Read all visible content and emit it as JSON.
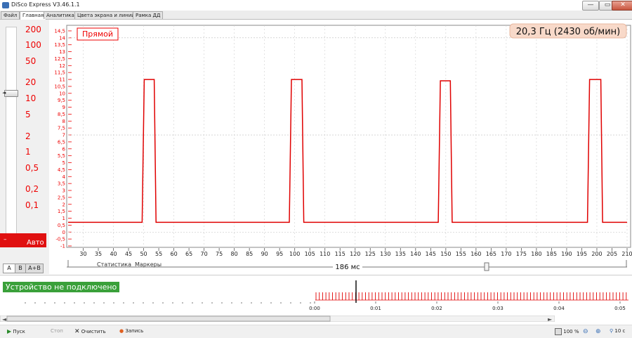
{
  "window": {
    "title": "DiSco Express V3.46.1.1",
    "minimize": "—",
    "maximize": "▭",
    "close": "✕"
  },
  "menu_tabs": [
    "Файл",
    "Главная",
    "Аналитика",
    "Цвета экрана и линий",
    "Рамка ДД"
  ],
  "left_panel": {
    "scale_labels": [
      "200",
      "100",
      "50",
      "20",
      "10",
      "5",
      "2",
      "1",
      "0,5",
      "0,2",
      "0,1"
    ],
    "slider_tick": "◄",
    "auto_dash": "–",
    "auto_label": "Авто",
    "channel_tabs": [
      "A",
      "B",
      "A+B"
    ],
    "selected_scale": "20"
  },
  "chart": {
    "mode_label": "Прямой",
    "frequency_readout": "20,3 Гц (2430 об/мин)",
    "statistics_label": "Статистика",
    "markers_label": "Маркеры",
    "span_label": "186 мс",
    "accent": "#e00000"
  },
  "chart_data": {
    "type": "line",
    "xlabel": "",
    "ylabel": "",
    "xlim": [
      25,
      210
    ],
    "ylim": [
      -1,
      14.7
    ],
    "x_ticks": [
      30,
      35,
      40,
      45,
      50,
      55,
      60,
      65,
      70,
      75,
      80,
      85,
      90,
      95,
      100,
      105,
      110,
      115,
      120,
      125,
      130,
      135,
      140,
      145,
      150,
      155,
      160,
      165,
      170,
      175,
      180,
      185,
      190,
      195,
      200,
      205,
      210
    ],
    "y_ticks": [
      "-1",
      "-0,5",
      "0",
      "0,5",
      "1",
      "1,5",
      "2",
      "2,5",
      "3",
      "3,5",
      "4",
      "4,5",
      "5",
      "5,5",
      "6",
      "6,5",
      "7",
      "7,5",
      "8",
      "8,5",
      "9",
      "9,5",
      "10",
      "10,5",
      "11",
      "11,5",
      "12",
      "12,5",
      "13",
      "13,5",
      "14",
      "14,5"
    ],
    "series": [
      {
        "x": [
          25,
          49.5,
          50.2,
          53.5,
          54.1,
          98.2,
          98.9,
          102.4,
          103.0,
          147.5,
          148.2,
          151.5,
          152.1,
          196.9,
          197.6,
          201.3,
          201.9,
          210
        ],
        "y": [
          0.7,
          0.7,
          11.0,
          11.0,
          0.7,
          0.7,
          11.0,
          11.0,
          0.7,
          0.7,
          10.9,
          10.9,
          0.7,
          0.7,
          11.0,
          11.0,
          0.7,
          0.7
        ]
      }
    ]
  },
  "status": {
    "connection": "Устройство не подключено"
  },
  "timeline": {
    "labels": [
      "0:00",
      "0:01",
      "0:02",
      "0:03",
      "0:04",
      "0:05"
    ],
    "color": "#e00000"
  },
  "toolbar": {
    "start": "Пуск",
    "stop": "Стоп",
    "clear": "Очистить",
    "record": "Запись",
    "zoom": "100 %",
    "time_span": "10 с"
  }
}
